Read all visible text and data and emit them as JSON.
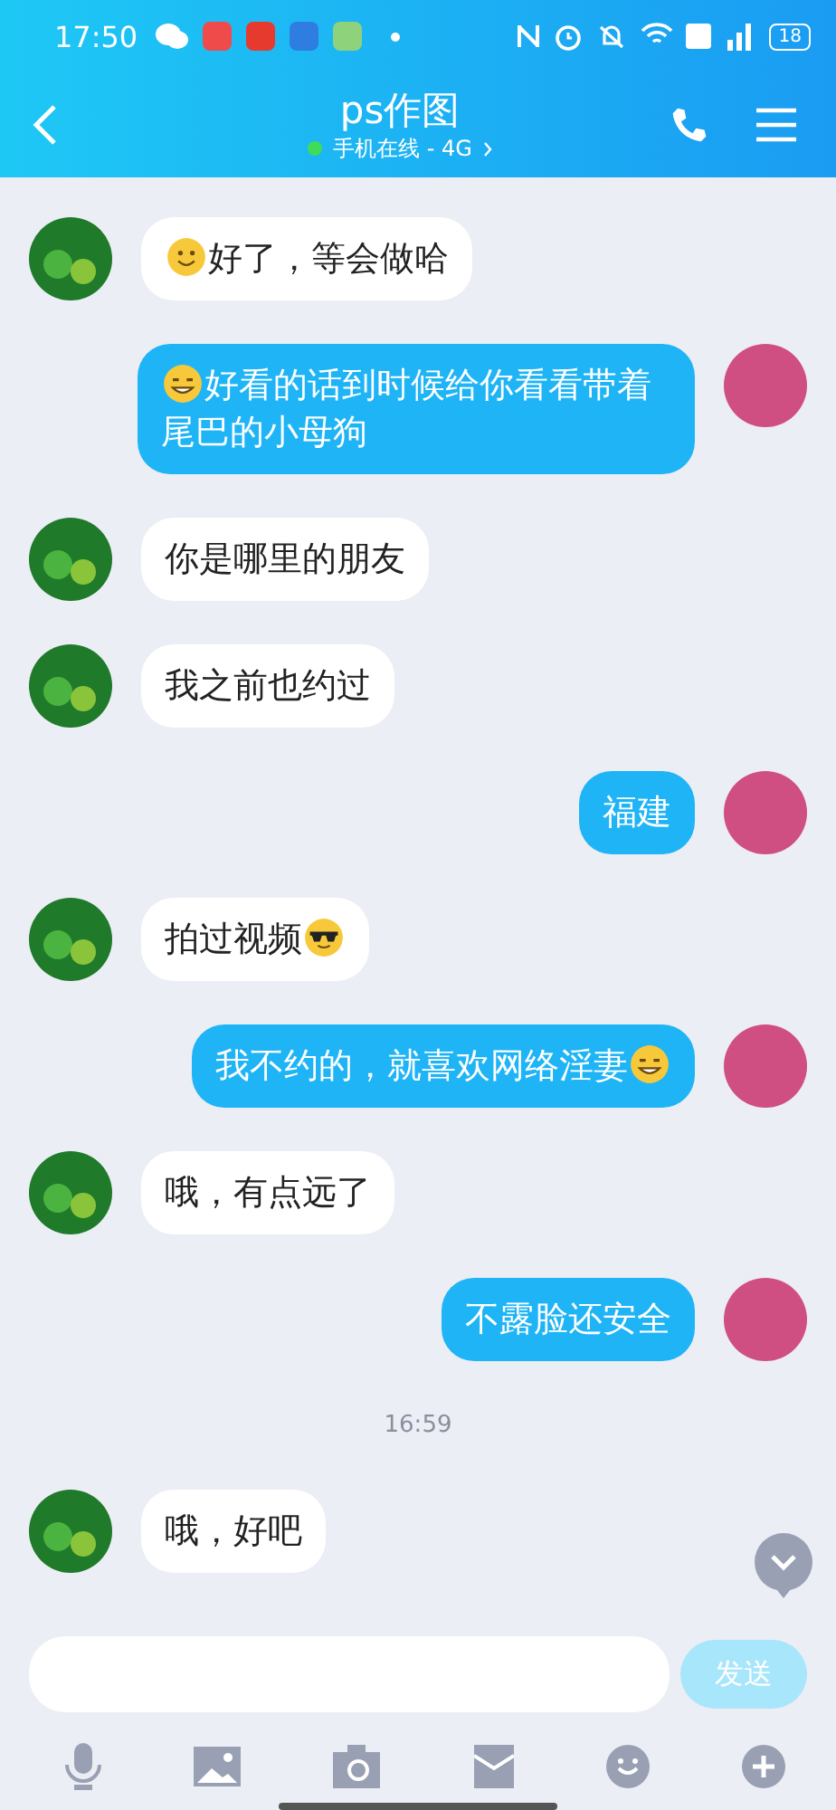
{
  "status_bar": {
    "time": "17:50",
    "battery": "18"
  },
  "header": {
    "title": "ps作图",
    "presence": "手机在线 - 4G",
    "online": true
  },
  "messages": [
    {
      "kind": "message",
      "outgoing": false,
      "parts": [
        {
          "kind": "smile"
        },
        {
          "kind": "text",
          "text": "好了，等会做哈"
        }
      ]
    },
    {
      "kind": "message",
      "outgoing": true,
      "parts": [
        {
          "kind": "grin"
        },
        {
          "kind": "text",
          "text": "好看的话到时候给你看看带着尾巴的小母狗"
        }
      ]
    },
    {
      "kind": "message",
      "outgoing": false,
      "parts": [
        {
          "kind": "text",
          "text": "你是哪里的朋友"
        }
      ]
    },
    {
      "kind": "message",
      "outgoing": false,
      "parts": [
        {
          "kind": "text",
          "text": "我之前也约过"
        }
      ]
    },
    {
      "kind": "message",
      "outgoing": true,
      "parts": [
        {
          "kind": "text",
          "text": "福建"
        }
      ]
    },
    {
      "kind": "message",
      "outgoing": false,
      "parts": [
        {
          "kind": "text",
          "text": "拍过视频"
        },
        {
          "kind": "sunglasses"
        }
      ]
    },
    {
      "kind": "message",
      "outgoing": true,
      "parts": [
        {
          "kind": "text",
          "text": "我不约的，就喜欢网络淫妻"
        },
        {
          "kind": "grin"
        }
      ]
    },
    {
      "kind": "message",
      "outgoing": false,
      "parts": [
        {
          "kind": "text",
          "text": "哦，有点远了"
        }
      ]
    },
    {
      "kind": "message",
      "outgoing": true,
      "parts": [
        {
          "kind": "text",
          "text": "不露脸还安全"
        }
      ]
    },
    {
      "kind": "time",
      "text": "16:59"
    },
    {
      "kind": "message",
      "outgoing": false,
      "parts": [
        {
          "kind": "text",
          "text": "哦，好吧"
        }
      ]
    }
  ],
  "composer": {
    "send_label": "发送",
    "send_enabled": false
  }
}
